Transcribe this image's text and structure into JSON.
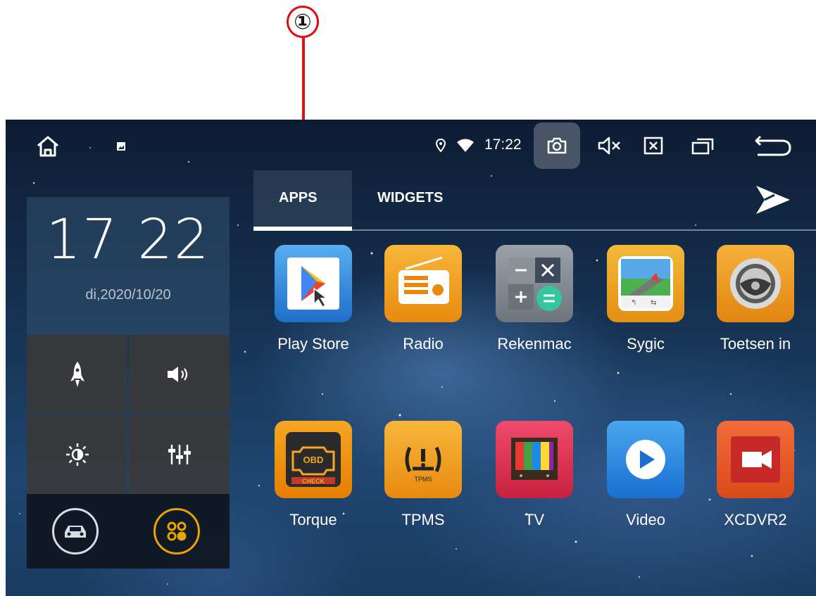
{
  "annotation": {
    "marker": "①"
  },
  "statusbar": {
    "time": "17:22"
  },
  "clock": {
    "time": "17 22",
    "date": "di,2020/10/20"
  },
  "tabs": [
    {
      "label": "APPS"
    },
    {
      "label": "WIDGETS"
    }
  ],
  "apps": [
    {
      "label": "Play Store"
    },
    {
      "label": "Radio"
    },
    {
      "label": "Rekenmac"
    },
    {
      "label": "Sygic"
    },
    {
      "label": "Toetsen in"
    },
    {
      "label": "Torque"
    },
    {
      "label": "TPMS"
    },
    {
      "label": "TV"
    },
    {
      "label": "Video"
    },
    {
      "label": "XCDVR2"
    }
  ],
  "icons": {
    "statusbar": [
      "home-icon",
      "notification-icon",
      "location-icon",
      "wifi-icon",
      "screenshot-icon",
      "mute-icon",
      "close-app-icon",
      "recent-apps-icon",
      "back-icon"
    ],
    "panel": [
      "rocket-icon",
      "volume-icon",
      "brightness-icon",
      "equalizer-icon",
      "car-icon",
      "apps-grid-icon"
    ],
    "tabs": [
      "play-media-icon"
    ]
  },
  "colors": {
    "annotation": "#e01010",
    "accent_ring": "#e8a400"
  }
}
